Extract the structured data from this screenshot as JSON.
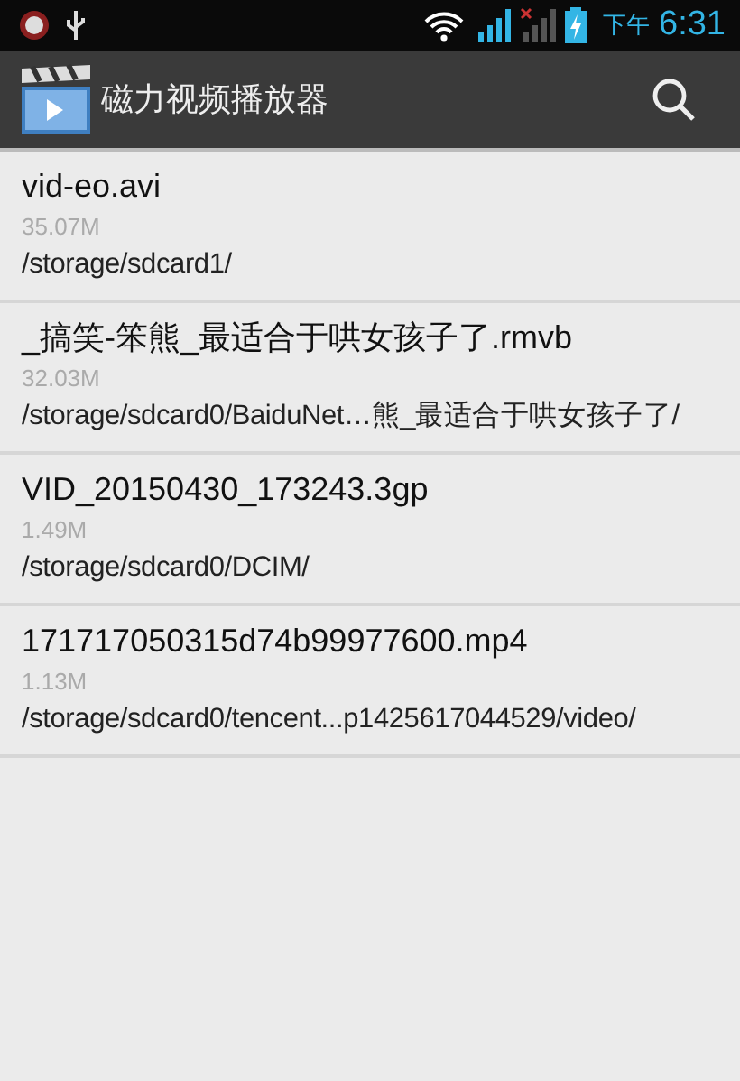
{
  "status_bar": {
    "period": "下午",
    "time": "6:31"
  },
  "action_bar": {
    "title": "磁力视频播放器"
  },
  "files": [
    {
      "name": "vid-eo.avi",
      "size": "35.07M",
      "path": "/storage/sdcard1/"
    },
    {
      "name": "_搞笑-笨熊_最适合于哄女孩子了.rmvb",
      "size": "32.03M",
      "path": "/storage/sdcard0/BaiduNet…熊_最适合于哄女孩子了/"
    },
    {
      "name": "VID_20150430_173243.3gp",
      "size": "1.49M",
      "path": "/storage/sdcard0/DCIM/"
    },
    {
      "name": "171717050315d74b99977600.mp4",
      "size": "1.13M",
      "path": "/storage/sdcard0/tencent...p1425617044529/video/"
    }
  ]
}
